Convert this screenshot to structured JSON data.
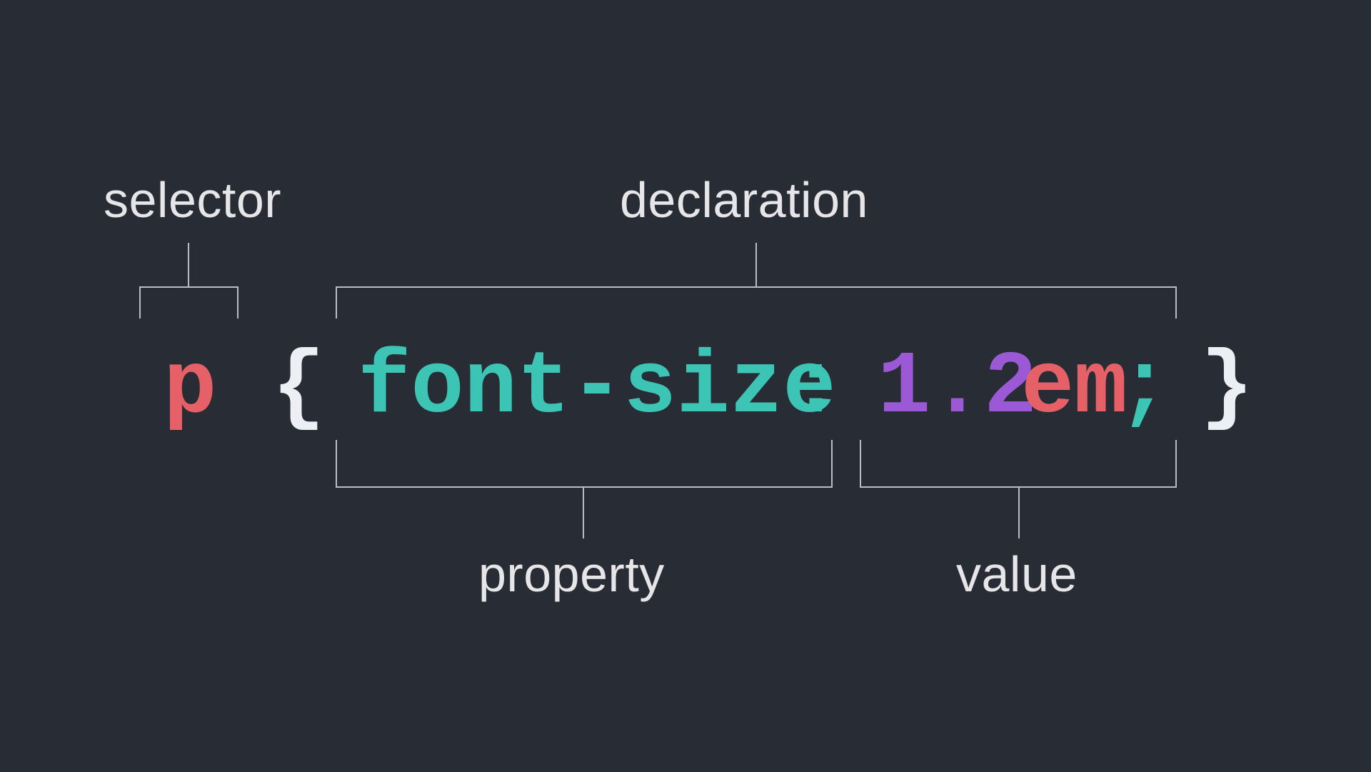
{
  "labels": {
    "selector": "selector",
    "declaration": "declaration",
    "property": "property",
    "value": "value"
  },
  "code": {
    "selector": "p",
    "open_brace": "{",
    "property": "font-size",
    "colon": ":",
    "number": "1.2",
    "unit": "em",
    "semicolon": ";",
    "close_brace": "}"
  },
  "colors": {
    "background": "#282c34",
    "label": "#e6e6e8",
    "bracket": "#b9bec6",
    "selector_red": "#e56067",
    "brace_white": "#eceff3",
    "property_teal": "#3cc4b4",
    "number_purple": "#9b59d6",
    "unit_red": "#e56067"
  }
}
